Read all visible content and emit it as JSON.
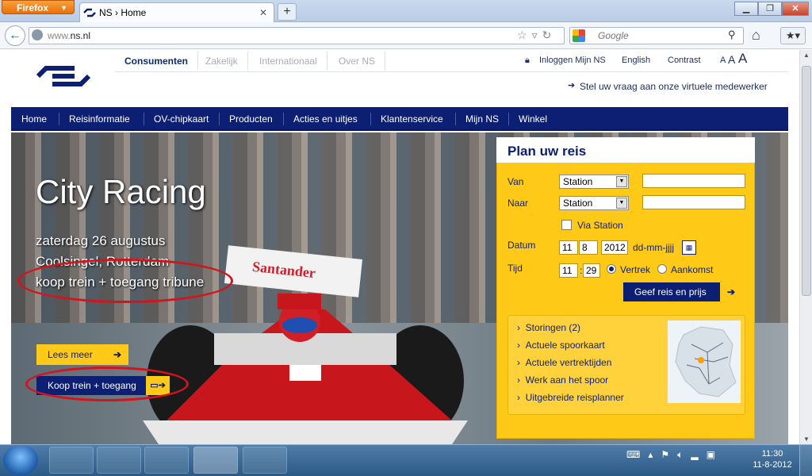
{
  "browser": {
    "app_button": "Firefox",
    "tab_title": "NS › Home",
    "url_prefix": "www.",
    "url_domain": "ns.nl",
    "search_placeholder": "Google"
  },
  "site": {
    "top_tabs": [
      "Consumenten",
      "Zakelijk",
      "Internationaal",
      "Over NS"
    ],
    "util_links": {
      "login": "Inloggen Mijn NS",
      "english": "English",
      "contrast": "Contrast",
      "font_a1": "A",
      "font_a2": "A",
      "font_a3": "A"
    },
    "assistant": "Stel uw vraag aan onze virtuele medewerker",
    "nav": [
      "Home",
      "Reisinformatie",
      "OV-chipkaart",
      "Producten",
      "Acties en uitjes",
      "Klantenservice",
      "Mijn NS",
      "Winkel"
    ]
  },
  "hero": {
    "title": "City Racing",
    "date": "zaterdag 26 augustus",
    "location": "Coolsingel, Rotterdam",
    "offer": "koop trein + toegang tribune",
    "read_more": "Lees meer",
    "buy_button": "Koop trein + toegang",
    "banner_text": "Santander"
  },
  "planner": {
    "title": "Plan uw reis",
    "from_label": "Van",
    "to_label": "Naar",
    "from_select": "Station",
    "to_select": "Station",
    "via_label": "Via Station",
    "date_label": "Datum",
    "day": "11",
    "month": "8",
    "year": "2012",
    "date_format": "dd-mm-jjjj",
    "time_label": "Tijd",
    "hour": "11",
    "time_sep": ":",
    "minute": "29",
    "depart_label": "Vertrek",
    "arrive_label": "Aankomst",
    "submit": "Geef reis en prijs",
    "links": [
      "Storingen (2)",
      "Actuele spoorkaart",
      "Actuele vertrektijden",
      "Werk aan het spoor",
      "Uitgebreide reisplanner"
    ]
  },
  "taskbar": {
    "time": "11:30",
    "date": "11-8-2012"
  },
  "colors": {
    "ns_blue": "#0d1f73",
    "ns_yellow": "#ffc917",
    "highlight_red": "#d4141c"
  }
}
